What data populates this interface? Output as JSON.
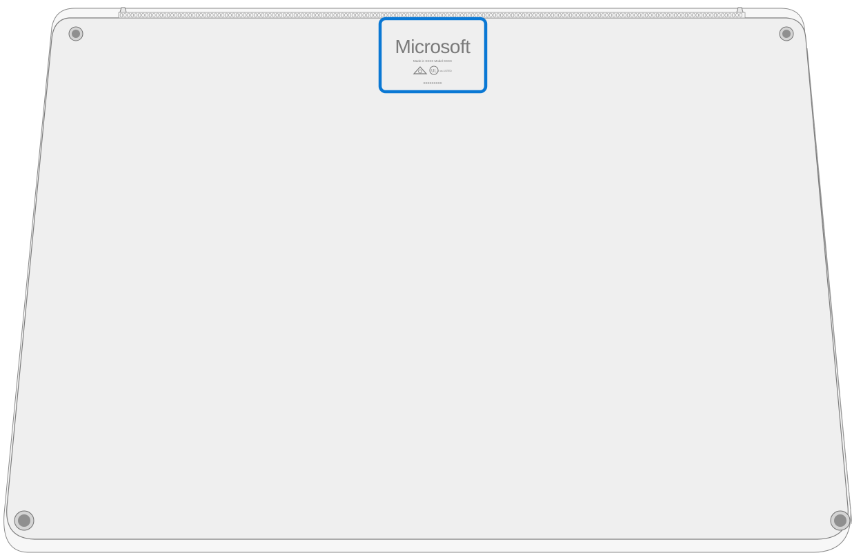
{
  "label": {
    "brand": "Microsoft",
    "made_in_line": "Made in XXXX Model XXXX",
    "serial_line": "XXXXXXXXX",
    "cert_text": "c us LISTED"
  },
  "colors": {
    "background": "#ffffff",
    "chassis_fill": "#efefef",
    "chassis_outline": "#7d7d7d",
    "highlight": "#0a78d4",
    "foot_outer": "#d4d4d4",
    "foot_inner": "#8f8f8f"
  },
  "icons": {
    "weee": "triangle-icon",
    "ul": "ul-listed-icon",
    "foot": "rubber-foot-icon"
  }
}
